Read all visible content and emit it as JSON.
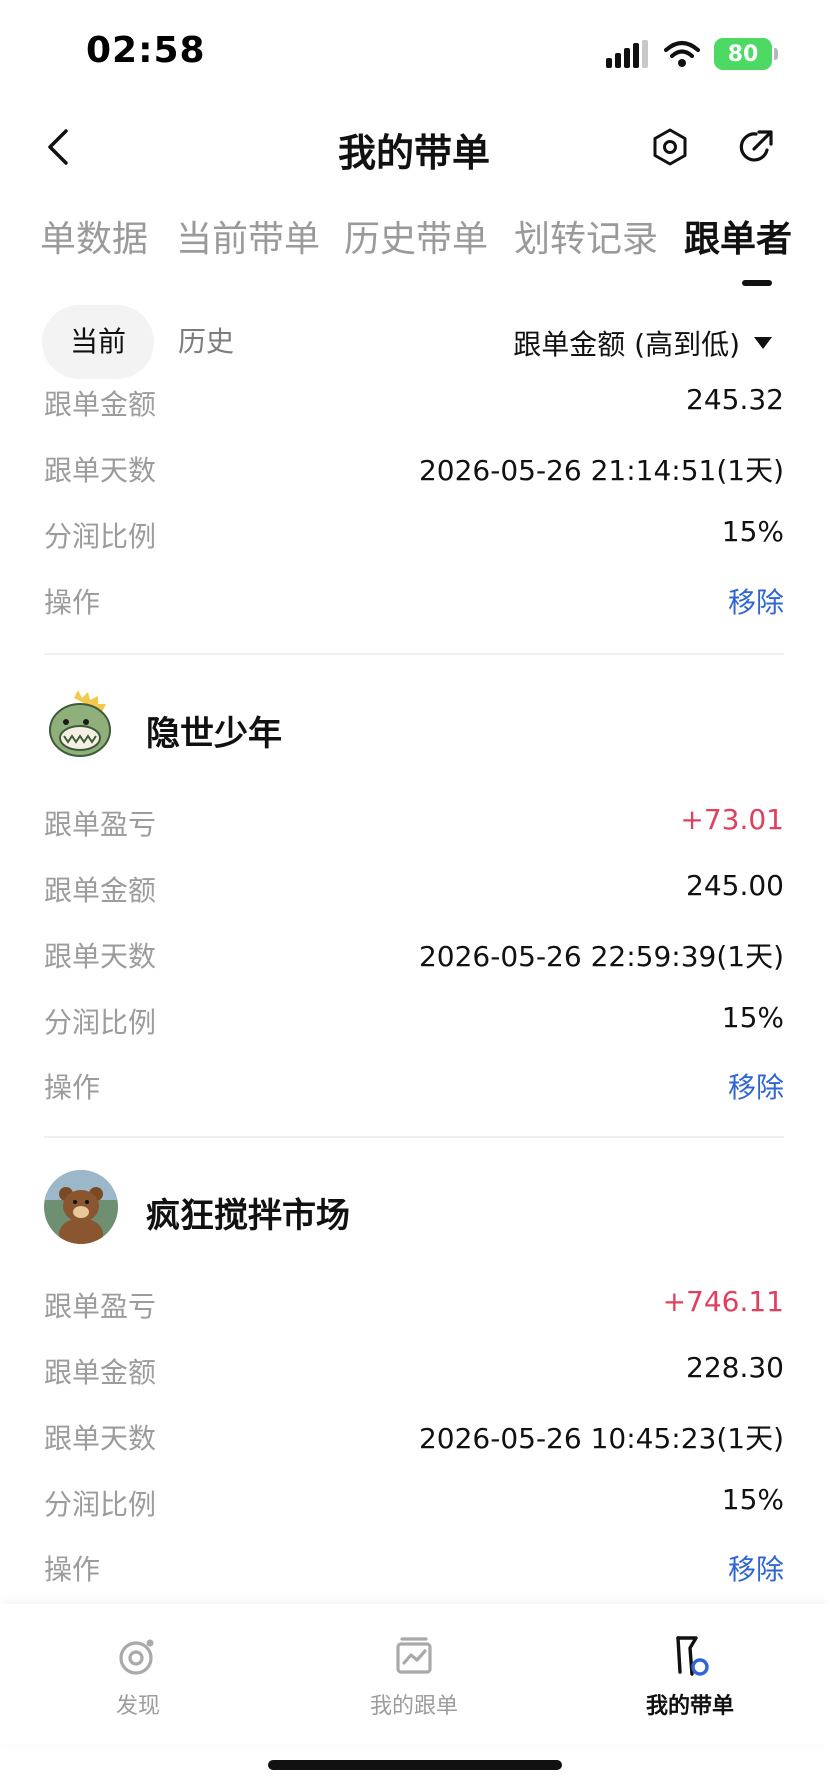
{
  "status_bar": {
    "time": "02:58",
    "battery": "80"
  },
  "nav": {
    "title": "我的带单"
  },
  "tabs": [
    {
      "label": "单数据",
      "active": false
    },
    {
      "label": "当前带单",
      "active": false
    },
    {
      "label": "历史带单",
      "active": false
    },
    {
      "label": "划转记录",
      "active": false
    },
    {
      "label": "跟单者",
      "active": true
    }
  ],
  "filter": {
    "current": "当前",
    "history": "历史",
    "sort_label": "跟单金额 (高到低)"
  },
  "first_entry": {
    "rows": [
      {
        "label": "跟单金额",
        "value": "245.32"
      },
      {
        "label": "跟单天数",
        "value": "2026-05-26 21:14:51(1天)"
      },
      {
        "label": "分润比例",
        "value": "15%"
      },
      {
        "label": "操作",
        "value": "移除"
      }
    ]
  },
  "followers": [
    {
      "name": "隐世少年",
      "avatar_icon": "dinosaur-avatar",
      "rows": [
        {
          "label": "跟单盈亏",
          "value": "+73.01"
        },
        {
          "label": "跟单金额",
          "value": "245.00"
        },
        {
          "label": "跟单天数",
          "value": "2026-05-26 22:59:39(1天)"
        },
        {
          "label": "分润比例",
          "value": "15%"
        },
        {
          "label": "操作",
          "value": "移除"
        }
      ]
    },
    {
      "name": "疯狂搅拌市场",
      "avatar_icon": "bear-avatar",
      "rows": [
        {
          "label": "跟单盈亏",
          "value": "+746.11"
        },
        {
          "label": "跟单金额",
          "value": "228.30"
        },
        {
          "label": "跟单天数",
          "value": "2026-05-26 10:45:23(1天)"
        },
        {
          "label": "分润比例",
          "value": "15%"
        },
        {
          "label": "操作",
          "value": "移除"
        }
      ]
    }
  ],
  "bottom_nav": [
    {
      "label": "发现",
      "icon": "discover-icon",
      "active": false
    },
    {
      "label": "我的跟单",
      "icon": "chart-icon",
      "active": false
    },
    {
      "label": "我的带单",
      "icon": "flag-icon",
      "active": true
    }
  ],
  "colors": {
    "positive": "#e0405e",
    "action": "#2f66d6",
    "muted": "#9c9c9c",
    "battery": "#4cd964"
  }
}
